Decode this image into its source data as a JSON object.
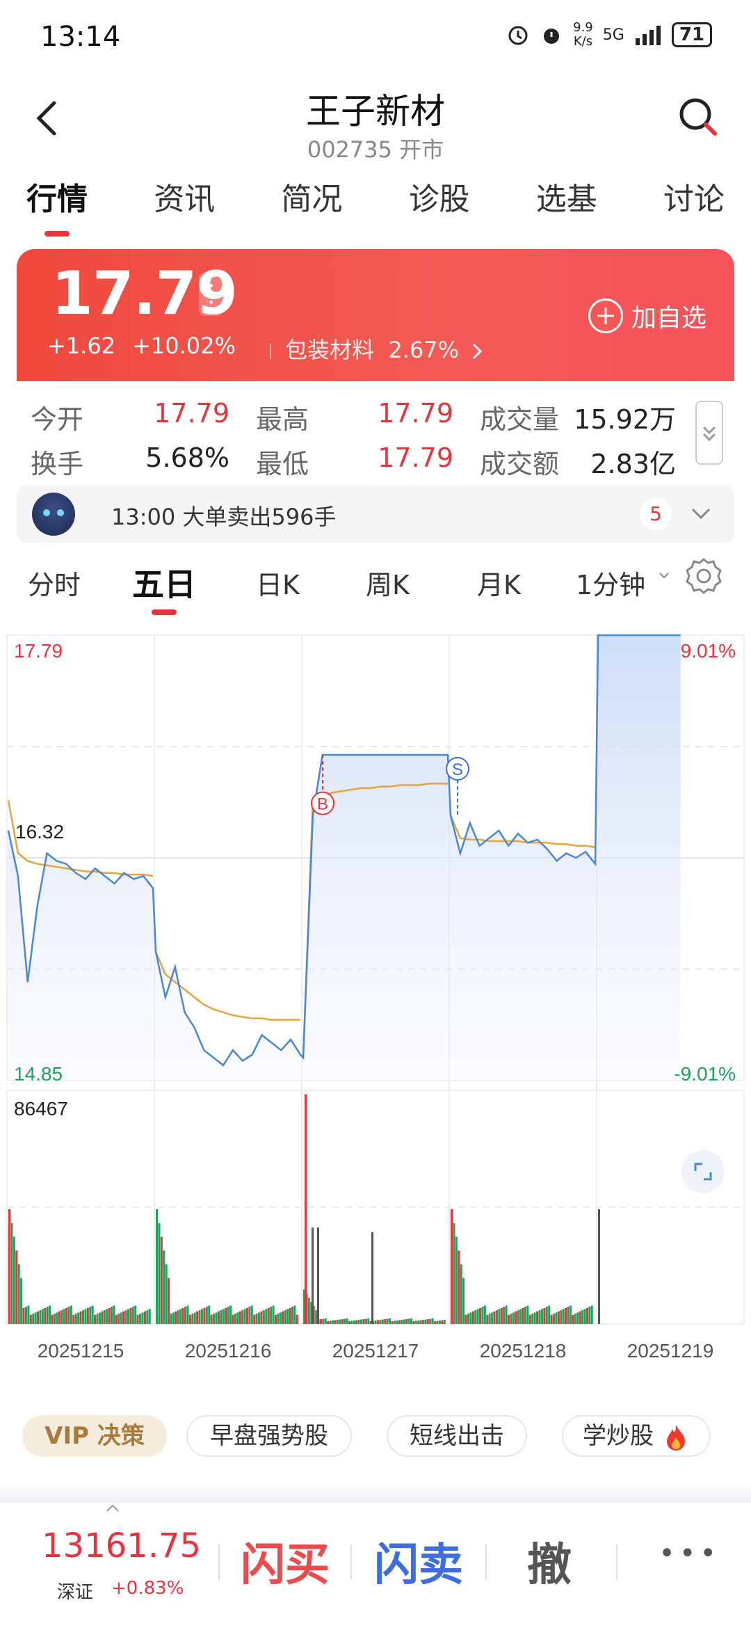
{
  "status_bar": {
    "time": "13:14",
    "net_speed": "9.9\nK/s",
    "signal": "5G",
    "battery": "71"
  },
  "header": {
    "title": "王子新材",
    "subtitle": "002735 开市"
  },
  "tabs": [
    "行情",
    "资讯",
    "简况",
    "诊股",
    "选基",
    "讨论"
  ],
  "quote": {
    "price": "17.79",
    "change": "+1.62",
    "change_pct": "+10.02%",
    "sector_name": "包装材料",
    "sector_pct": "2.67%",
    "watch_label": "加自选"
  },
  "stats": {
    "open_label": "今开",
    "open": "17.79",
    "high_label": "最高",
    "high": "17.79",
    "volume_label": "成交量",
    "volume": "15.92万",
    "turnover_label": "换手",
    "turnover": "5.68%",
    "low_label": "最低",
    "low": "17.79",
    "amount_label": "成交额",
    "amount": "2.83亿"
  },
  "notice": {
    "text": "13:00 大单卖出596手",
    "count": "5"
  },
  "chart_tabs": [
    "分时",
    "五日",
    "日K",
    "周K",
    "月K",
    "1分钟"
  ],
  "chart_data": {
    "type": "line",
    "price_axis": {
      "max": "17.79",
      "min": "14.85",
      "mid_label": "16.32",
      "max_pct": "9.01%",
      "min_pct": "-9.01%"
    },
    "volume_axis_max": "86467",
    "dates": [
      "20251215",
      "20251216",
      "20251217",
      "20251218",
      "20251219"
    ],
    "markers": {
      "buy": "B",
      "sell": "S"
    },
    "series": [
      {
        "day": "20251215",
        "price": [
          16.5,
          16.2,
          15.5,
          16.0,
          16.35,
          16.3,
          16.28,
          16.22,
          16.18,
          16.25,
          16.2,
          16.15,
          16.22,
          16.18,
          16.2,
          16.12
        ],
        "avg": [
          16.7,
          16.35,
          16.3,
          16.28,
          16.27,
          16.26,
          16.25,
          16.24,
          16.23,
          16.23,
          16.22,
          16.22,
          16.21,
          16.21,
          16.21,
          16.2
        ]
      },
      {
        "day": "20251216",
        "price": [
          15.7,
          15.4,
          15.6,
          15.3,
          15.2,
          15.05,
          15.0,
          14.95,
          15.05,
          14.98,
          15.02,
          15.15,
          15.1,
          15.05,
          15.12,
          15.02
        ],
        "avg": [
          15.7,
          15.55,
          15.5,
          15.45,
          15.4,
          15.35,
          15.32,
          15.3,
          15.28,
          15.27,
          15.26,
          15.26,
          15.25,
          15.25,
          15.25,
          15.25
        ]
      },
      {
        "day": "20251217",
        "price": [
          15.0,
          16.6,
          17.0,
          17.0,
          17.0,
          17.0,
          17.0,
          17.0,
          17.0,
          17.0,
          17.0,
          17.0,
          17.0,
          17.0,
          17.0,
          17.0
        ],
        "avg": [
          15.0,
          16.7,
          16.73,
          16.75,
          16.76,
          16.77,
          16.78,
          16.78,
          16.79,
          16.79,
          16.8,
          16.8,
          16.8,
          16.81,
          16.81,
          16.81
        ]
      },
      {
        "day": "20251218",
        "price": [
          16.6,
          16.35,
          16.55,
          16.4,
          16.45,
          16.5,
          16.4,
          16.48,
          16.42,
          16.44,
          16.38,
          16.3,
          16.35,
          16.32,
          16.36,
          16.28
        ],
        "avg": [
          16.6,
          16.45,
          16.44,
          16.44,
          16.43,
          16.43,
          16.43,
          16.43,
          16.42,
          16.42,
          16.42,
          16.41,
          16.41,
          16.4,
          16.4,
          16.39
        ]
      },
      {
        "day": "20251219",
        "price": [
          17.79,
          17.79
        ],
        "avg": []
      }
    ]
  },
  "chips": [
    "VIP 决策",
    "早盘强势股",
    "短线出击",
    "学炒股"
  ],
  "bottom": {
    "index_value": "13161.75",
    "index_name": "深证",
    "index_change": "+0.83%",
    "buy": "闪买",
    "sell": "闪卖",
    "cancel": "撤",
    "more": "•••"
  },
  "colors": {
    "up": "#e8323c",
    "down": "#1ea35a",
    "line": "#4a86d6",
    "avg": "#e8a33a"
  }
}
